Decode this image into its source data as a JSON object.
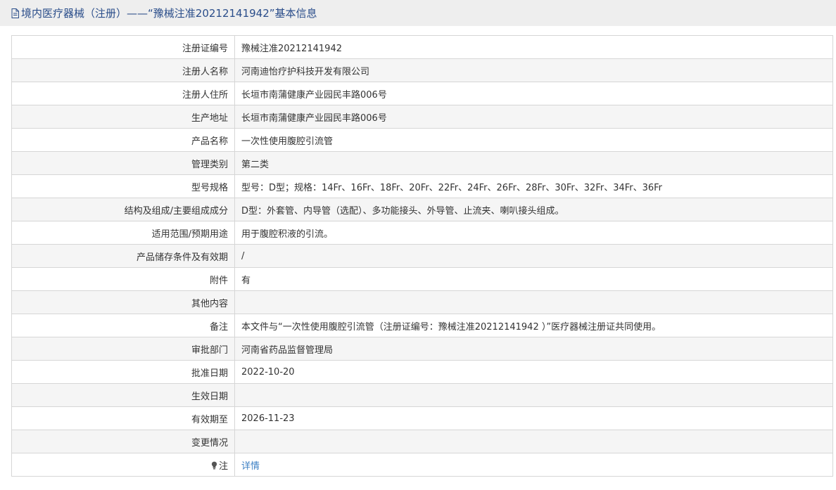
{
  "header": {
    "icon": "document-icon",
    "title": "境内医疗器械（注册）——“豫械注准20212141942”基本信息"
  },
  "rows": [
    {
      "label": "注册证编号",
      "value": "豫械注准20212141942"
    },
    {
      "label": "注册人名称",
      "value": "河南迪怡疗护科技开发有限公司"
    },
    {
      "label": "注册人住所",
      "value": "长垣市南蒲健康产业园民丰路006号"
    },
    {
      "label": "生产地址",
      "value": "长垣市南蒲健康产业园民丰路006号"
    },
    {
      "label": "产品名称",
      "value": "一次性使用腹腔引流管"
    },
    {
      "label": "管理类别",
      "value": "第二类"
    },
    {
      "label": "型号规格",
      "value": "型号：D型；规格：14Fr、16Fr、18Fr、20Fr、22Fr、24Fr、26Fr、28Fr、30Fr、32Fr、34Fr、36Fr"
    },
    {
      "label": "结构及组成/主要组成成分",
      "value": "D型：外套管、内导管（选配）、多功能接头、外导管、止流夹、喇叭接头组成。"
    },
    {
      "label": "适用范围/预期用途",
      "value": "用于腹腔积液的引流。"
    },
    {
      "label": "产品储存条件及有效期",
      "value": "/"
    },
    {
      "label": "附件",
      "value": "有"
    },
    {
      "label": "其他内容",
      "value": ""
    },
    {
      "label": "备注",
      "value": "本文件与“一次性使用腹腔引流管（注册证编号：豫械注准20212141942 ）”医疗器械注册证共同使用。"
    },
    {
      "label": "审批部门",
      "value": "河南省药品监督管理局"
    },
    {
      "label": "批准日期",
      "value": "2022-10-20"
    },
    {
      "label": "生效日期",
      "value": ""
    },
    {
      "label": "有效期至",
      "value": "2026-11-23"
    },
    {
      "label": "变更情况",
      "value": ""
    }
  ],
  "note_row": {
    "icon": "lightbulb-icon",
    "label": "注",
    "link_text": "详情"
  },
  "colors": {
    "header_bg": "#eeeeee",
    "title_color": "#2a4d8a",
    "link_color": "#3b7fc4",
    "row_alt_bg": "#f5f5f5",
    "border": "#d6d6d6"
  }
}
